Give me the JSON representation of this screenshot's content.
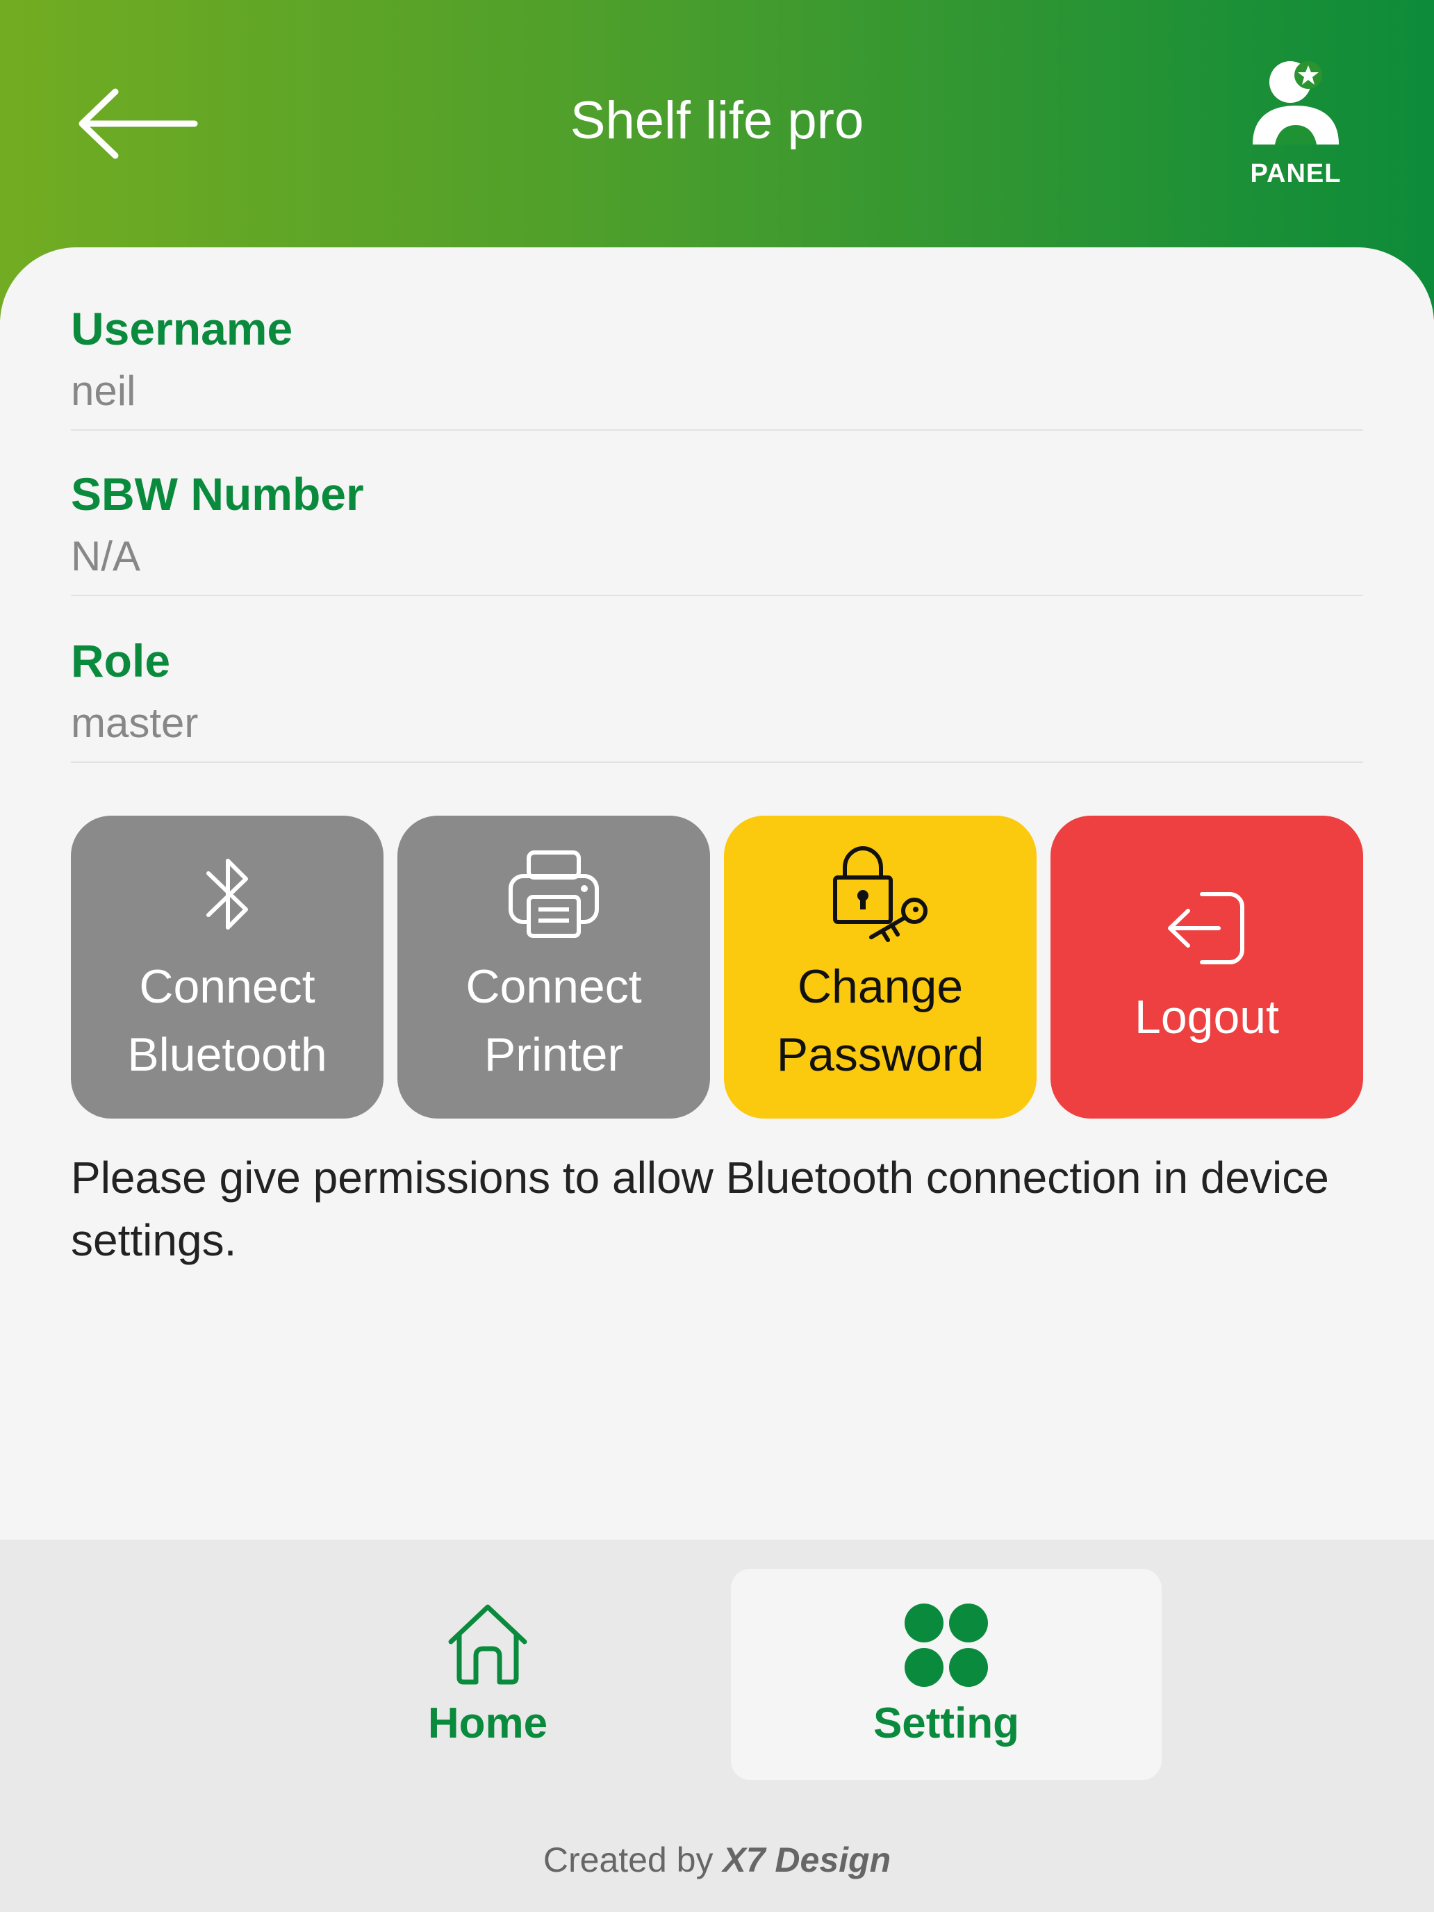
{
  "header": {
    "title": "Shelf life pro",
    "back_icon": "arrow-left-icon",
    "panel_label": "PANEL",
    "panel_icon": "user-star-icon"
  },
  "profile": {
    "fields": [
      {
        "label": "Username",
        "value": "neil"
      },
      {
        "label": "SBW Number",
        "value": "N/A"
      },
      {
        "label": "Role",
        "value": "master"
      }
    ]
  },
  "actions": [
    {
      "label": "Connect\nBluetooth",
      "icon": "bluetooth-icon",
      "color": "#8a8a8a"
    },
    {
      "label": "Connect\nPrinter",
      "icon": "printer-icon",
      "color": "#8a8a8a"
    },
    {
      "label": "Change\nPassword",
      "icon": "lock-key-icon",
      "color": "#fbc90d"
    },
    {
      "label": "Logout",
      "icon": "logout-icon",
      "color": "#ee4040"
    }
  ],
  "notice": "Please give permissions to allow Bluetooth connection in device settings.",
  "bottom_nav": {
    "tabs": [
      {
        "label": "Home",
        "icon": "home-icon",
        "active": false
      },
      {
        "label": "Setting",
        "icon": "grid-dots-icon",
        "active": true
      }
    ]
  },
  "footer": {
    "prefix": "Created by",
    "brand": "X7 Design"
  },
  "colors": {
    "brand_green": "#0a8a3c",
    "header_gradient_start": "#72ac22",
    "header_gradient_end": "#0d8b3a"
  }
}
